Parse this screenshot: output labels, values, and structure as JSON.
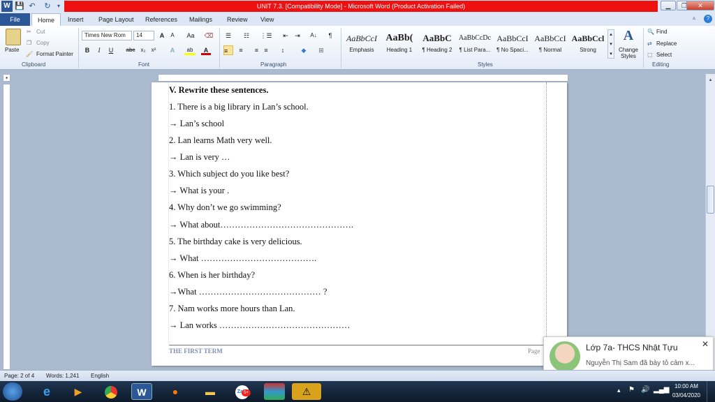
{
  "window": {
    "title": "UNIT 7.3. [Compatibility Mode] - Microsoft Word (Product Activation Failed)",
    "min_label": "▁",
    "max_label": "❐",
    "close_label": "✕",
    "help_label": "?"
  },
  "quick_access": {
    "word_icon": "W",
    "save": "💾",
    "undo": "↶",
    "redo": "↻"
  },
  "tabs": [
    "File",
    "Home",
    "Insert",
    "Page Layout",
    "References",
    "Mailings",
    "Review",
    "View"
  ],
  "clipboard": {
    "paste": "Paste",
    "cut": "Cut",
    "copy": "Copy",
    "format_painter": "Format Painter",
    "group_label": "Clipboard"
  },
  "font": {
    "name": "Times New Rom",
    "size": "14",
    "grow": "A",
    "shrink": "A",
    "case": "Aa",
    "clear": "⌫",
    "bold": "B",
    "italic": "I",
    "underline": "U",
    "strike": "abc",
    "subscript": "x₂",
    "superscript": "x²",
    "effects": "A",
    "highlight": "ab",
    "color": "A",
    "group_label": "Font"
  },
  "paragraph": {
    "bullets": "☰",
    "numbering": "☷",
    "multilevel": "⋮☰",
    "decrease_indent": "⇤",
    "increase_indent": "⇥",
    "sort": "A↓",
    "show_marks": "¶",
    "align_left": "≡",
    "center": "≡",
    "align_right": "≡",
    "justify": "≡",
    "line_spacing": "↕",
    "shading": "◆",
    "borders": "⊞",
    "group_label": "Paragraph"
  },
  "styles": {
    "items": [
      {
        "sample": "AaBbCcI",
        "name": "Emphasis"
      },
      {
        "sample": "AaBb(",
        "name": "Heading 1"
      },
      {
        "sample": "AaBbC",
        "name": "¶ Heading 2"
      },
      {
        "sample": "AaBbCcDc",
        "name": "¶ List Para..."
      },
      {
        "sample": "AaBbCcI",
        "name": "¶ No Spaci..."
      },
      {
        "sample": "AaBbCcI",
        "name": "¶ Normal"
      },
      {
        "sample": "AaBbCcl",
        "name": "Strong"
      }
    ],
    "change_styles": "Change Styles",
    "group_label": "Styles"
  },
  "editing": {
    "find": "Find",
    "replace": "Replace",
    "select": "Select",
    "group_label": "Editing"
  },
  "document": {
    "lines": [
      "V. Rewrite these sentences.",
      "1. There is a big library in Lan’s school.",
      "→ Lan’s school",
      "2. Lan learns Math very well.",
      "→ Lan is very …",
      "3. Which subject do you like best?",
      "→ What is your .",
      "4. Why don’t we go swimming?",
      "→ What about……………………………………….",
      "5. The birthday cake is very delicious.",
      "→ What ………………………………….",
      "6. When is her birthday?",
      "→What ……………………………………    ?",
      "7. Nam works more hours than Lan.",
      "→ Lan works ………………………………………"
    ],
    "footer_left": "THE FIRST TERM",
    "footer_right": "Page"
  },
  "statusbar": {
    "page": "Page: 2 of 4",
    "words": "Words: 1,241",
    "language": "English"
  },
  "notification": {
    "title": "Lớp 7a- THCS Nhật Tựu",
    "body": "Nguyễn Thị Sam đã bày tỏ cảm x...",
    "close": "✕"
  },
  "taskbar": {
    "time": "10:00 AM",
    "date": "03/04/2020",
    "zalo_badge": "5+"
  },
  "colors": {
    "title_red": "#ee1111",
    "file_tab": "#2b5797",
    "font_color_red": "#d00000",
    "highlight_yellow": "#ffff00",
    "footer_blue": "#7f8db6"
  }
}
